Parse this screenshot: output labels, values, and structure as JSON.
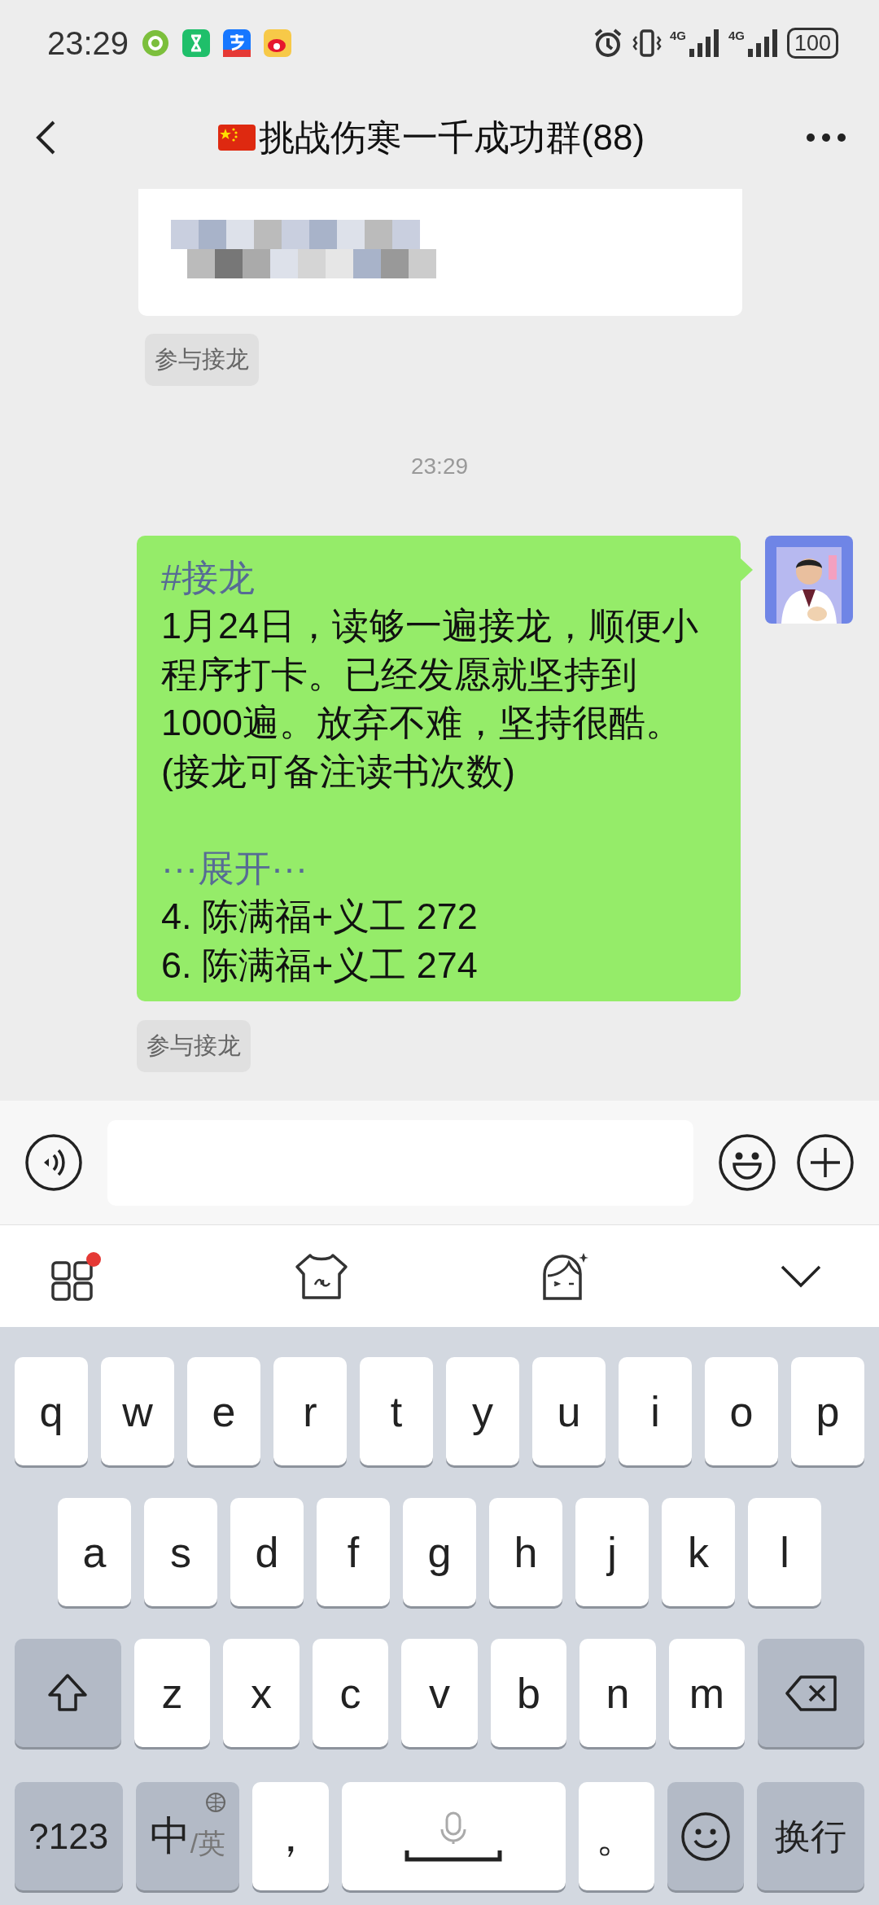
{
  "status_bar": {
    "time": "23:29",
    "network_labels": [
      "4G",
      "4G"
    ],
    "battery": "100"
  },
  "header": {
    "title": "挑战伤寒一千成功群(88)"
  },
  "messages": [
    {
      "kind": "redacted",
      "chip": "参与接龙"
    },
    {
      "kind": "timestamp",
      "text": "23:29"
    },
    {
      "kind": "bubble",
      "tag": "#接龙",
      "body_lines": [
        "1月24日，读够一遍接龙，顺便小",
        "程序打卡。已经发愿就坚持到",
        "1000遍。放弃不难，坚持很酷。",
        "(接龙可备注读书次数)"
      ],
      "expand": "···展开···",
      "entries": [
        "4. 陈满福+义工 272",
        "6. 陈满福+义工 274"
      ],
      "chip": "参与接龙"
    }
  ],
  "toolbar": {
    "apps_badge": true
  },
  "keyboard": {
    "letter_rows": [
      [
        {
          "kind": "char",
          "label": "q"
        },
        {
          "kind": "char",
          "label": "w"
        },
        {
          "kind": "char",
          "label": "e"
        },
        {
          "kind": "char",
          "label": "r"
        },
        {
          "kind": "char",
          "label": "t"
        },
        {
          "kind": "char",
          "label": "y"
        },
        {
          "kind": "char",
          "label": "u"
        },
        {
          "kind": "char",
          "label": "i"
        },
        {
          "kind": "char",
          "label": "o"
        },
        {
          "kind": "char",
          "label": "p"
        }
      ],
      [
        {
          "kind": "char",
          "label": "a"
        },
        {
          "kind": "char",
          "label": "s"
        },
        {
          "kind": "char",
          "label": "d"
        },
        {
          "kind": "char",
          "label": "f"
        },
        {
          "kind": "char",
          "label": "g"
        },
        {
          "kind": "char",
          "label": "h"
        },
        {
          "kind": "char",
          "label": "j"
        },
        {
          "kind": "char",
          "label": "k"
        },
        {
          "kind": "char",
          "label": "l"
        }
      ],
      [
        {
          "kind": "shift"
        },
        {
          "kind": "char",
          "label": "z"
        },
        {
          "kind": "char",
          "label": "x"
        },
        {
          "kind": "char",
          "label": "c"
        },
        {
          "kind": "char",
          "label": "v"
        },
        {
          "kind": "char",
          "label": "b"
        },
        {
          "kind": "char",
          "label": "n"
        },
        {
          "kind": "char",
          "label": "m"
        },
        {
          "kind": "backspace"
        }
      ]
    ],
    "bottom_row": [
      {
        "kind": "function",
        "label": "?123"
      },
      {
        "kind": "lang",
        "label": "中",
        "sub": "/英"
      },
      {
        "kind": "punct",
        "label": "，"
      },
      {
        "kind": "space"
      },
      {
        "kind": "punct",
        "label": "。"
      },
      {
        "kind": "emoji"
      },
      {
        "kind": "function",
        "label": "换行"
      }
    ]
  }
}
